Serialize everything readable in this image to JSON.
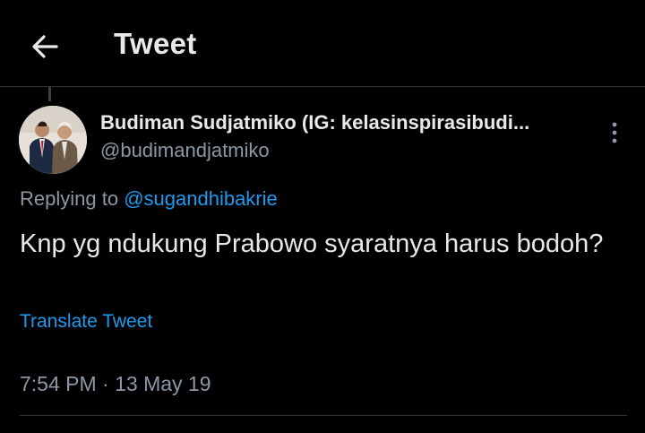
{
  "header": {
    "title": "Tweet",
    "back_icon": "arrow-left-icon"
  },
  "tweet": {
    "display_name": "Budiman Sudjatmiko (IG: kelasinspirasibudi...",
    "handle": "@budimandjatmiko",
    "replying_prefix": "Replying to",
    "replying_to": "@sugandhibakrie",
    "text": "Knp yg ndukung Prabowo syaratnya harus bodoh?",
    "translate_label": "Translate Tweet",
    "time": "7:54 PM",
    "separator": "·",
    "date": "13 May 19"
  },
  "colors": {
    "background": "#000000",
    "text_primary": "#e7e9ea",
    "text_secondary": "#8b98a5",
    "link": "#1d9bf0",
    "divider": "#2f3336"
  }
}
